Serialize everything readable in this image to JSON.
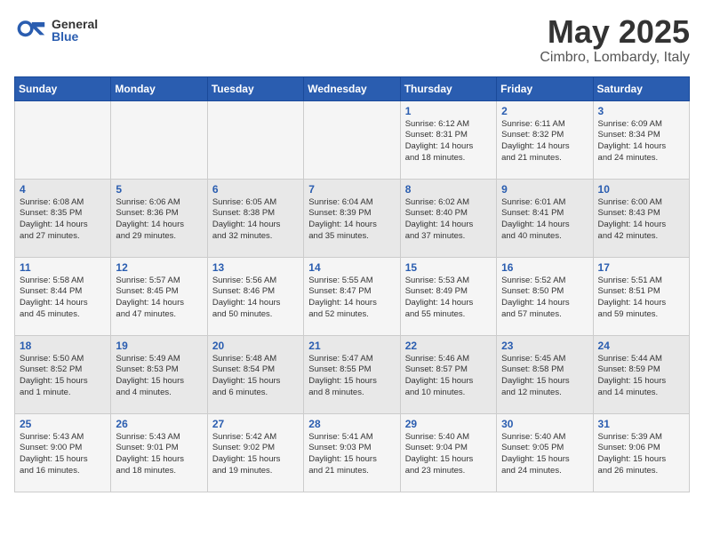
{
  "header": {
    "logo_general": "General",
    "logo_blue": "Blue",
    "month": "May 2025",
    "location": "Cimbro, Lombardy, Italy"
  },
  "weekdays": [
    "Sunday",
    "Monday",
    "Tuesday",
    "Wednesday",
    "Thursday",
    "Friday",
    "Saturday"
  ],
  "weeks": [
    [
      {
        "day": "",
        "info": ""
      },
      {
        "day": "",
        "info": ""
      },
      {
        "day": "",
        "info": ""
      },
      {
        "day": "",
        "info": ""
      },
      {
        "day": "1",
        "info": "Sunrise: 6:12 AM\nSunset: 8:31 PM\nDaylight: 14 hours\nand 18 minutes."
      },
      {
        "day": "2",
        "info": "Sunrise: 6:11 AM\nSunset: 8:32 PM\nDaylight: 14 hours\nand 21 minutes."
      },
      {
        "day": "3",
        "info": "Sunrise: 6:09 AM\nSunset: 8:34 PM\nDaylight: 14 hours\nand 24 minutes."
      }
    ],
    [
      {
        "day": "4",
        "info": "Sunrise: 6:08 AM\nSunset: 8:35 PM\nDaylight: 14 hours\nand 27 minutes."
      },
      {
        "day": "5",
        "info": "Sunrise: 6:06 AM\nSunset: 8:36 PM\nDaylight: 14 hours\nand 29 minutes."
      },
      {
        "day": "6",
        "info": "Sunrise: 6:05 AM\nSunset: 8:38 PM\nDaylight: 14 hours\nand 32 minutes."
      },
      {
        "day": "7",
        "info": "Sunrise: 6:04 AM\nSunset: 8:39 PM\nDaylight: 14 hours\nand 35 minutes."
      },
      {
        "day": "8",
        "info": "Sunrise: 6:02 AM\nSunset: 8:40 PM\nDaylight: 14 hours\nand 37 minutes."
      },
      {
        "day": "9",
        "info": "Sunrise: 6:01 AM\nSunset: 8:41 PM\nDaylight: 14 hours\nand 40 minutes."
      },
      {
        "day": "10",
        "info": "Sunrise: 6:00 AM\nSunset: 8:43 PM\nDaylight: 14 hours\nand 42 minutes."
      }
    ],
    [
      {
        "day": "11",
        "info": "Sunrise: 5:58 AM\nSunset: 8:44 PM\nDaylight: 14 hours\nand 45 minutes."
      },
      {
        "day": "12",
        "info": "Sunrise: 5:57 AM\nSunset: 8:45 PM\nDaylight: 14 hours\nand 47 minutes."
      },
      {
        "day": "13",
        "info": "Sunrise: 5:56 AM\nSunset: 8:46 PM\nDaylight: 14 hours\nand 50 minutes."
      },
      {
        "day": "14",
        "info": "Sunrise: 5:55 AM\nSunset: 8:47 PM\nDaylight: 14 hours\nand 52 minutes."
      },
      {
        "day": "15",
        "info": "Sunrise: 5:53 AM\nSunset: 8:49 PM\nDaylight: 14 hours\nand 55 minutes."
      },
      {
        "day": "16",
        "info": "Sunrise: 5:52 AM\nSunset: 8:50 PM\nDaylight: 14 hours\nand 57 minutes."
      },
      {
        "day": "17",
        "info": "Sunrise: 5:51 AM\nSunset: 8:51 PM\nDaylight: 14 hours\nand 59 minutes."
      }
    ],
    [
      {
        "day": "18",
        "info": "Sunrise: 5:50 AM\nSunset: 8:52 PM\nDaylight: 15 hours\nand 1 minute."
      },
      {
        "day": "19",
        "info": "Sunrise: 5:49 AM\nSunset: 8:53 PM\nDaylight: 15 hours\nand 4 minutes."
      },
      {
        "day": "20",
        "info": "Sunrise: 5:48 AM\nSunset: 8:54 PM\nDaylight: 15 hours\nand 6 minutes."
      },
      {
        "day": "21",
        "info": "Sunrise: 5:47 AM\nSunset: 8:55 PM\nDaylight: 15 hours\nand 8 minutes."
      },
      {
        "day": "22",
        "info": "Sunrise: 5:46 AM\nSunset: 8:57 PM\nDaylight: 15 hours\nand 10 minutes."
      },
      {
        "day": "23",
        "info": "Sunrise: 5:45 AM\nSunset: 8:58 PM\nDaylight: 15 hours\nand 12 minutes."
      },
      {
        "day": "24",
        "info": "Sunrise: 5:44 AM\nSunset: 8:59 PM\nDaylight: 15 hours\nand 14 minutes."
      }
    ],
    [
      {
        "day": "25",
        "info": "Sunrise: 5:43 AM\nSunset: 9:00 PM\nDaylight: 15 hours\nand 16 minutes."
      },
      {
        "day": "26",
        "info": "Sunrise: 5:43 AM\nSunset: 9:01 PM\nDaylight: 15 hours\nand 18 minutes."
      },
      {
        "day": "27",
        "info": "Sunrise: 5:42 AM\nSunset: 9:02 PM\nDaylight: 15 hours\nand 19 minutes."
      },
      {
        "day": "28",
        "info": "Sunrise: 5:41 AM\nSunset: 9:03 PM\nDaylight: 15 hours\nand 21 minutes."
      },
      {
        "day": "29",
        "info": "Sunrise: 5:40 AM\nSunset: 9:04 PM\nDaylight: 15 hours\nand 23 minutes."
      },
      {
        "day": "30",
        "info": "Sunrise: 5:40 AM\nSunset: 9:05 PM\nDaylight: 15 hours\nand 24 minutes."
      },
      {
        "day": "31",
        "info": "Sunrise: 5:39 AM\nSunset: 9:06 PM\nDaylight: 15 hours\nand 26 minutes."
      }
    ]
  ]
}
